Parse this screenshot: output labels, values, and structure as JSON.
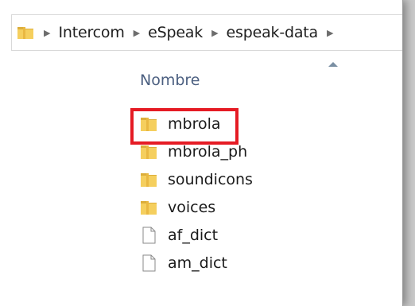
{
  "address_bar": {
    "icon": "folder-icon",
    "separator_glyph": "▶",
    "crumbs": [
      "Intercom",
      "eSpeak",
      "espeak-data"
    ]
  },
  "columns": {
    "name_header": "Nombre",
    "sort_indicator": "sort-ascending-icon"
  },
  "files": [
    {
      "name": "mbrola",
      "type": "folder",
      "icon": "folder-icon",
      "highlighted": true
    },
    {
      "name": "mbrola_ph",
      "type": "folder",
      "icon": "folder-icon"
    },
    {
      "name": "soundicons",
      "type": "folder",
      "icon": "folder-icon"
    },
    {
      "name": "voices",
      "type": "folder",
      "icon": "folder-icon"
    },
    {
      "name": "af_dict",
      "type": "file",
      "icon": "file-icon"
    },
    {
      "name": "am_dict",
      "type": "file",
      "icon": "file-icon"
    }
  ],
  "colors": {
    "highlight": "#e51b24",
    "folder": "#f0c14b",
    "header_text": "#4b5f80"
  }
}
